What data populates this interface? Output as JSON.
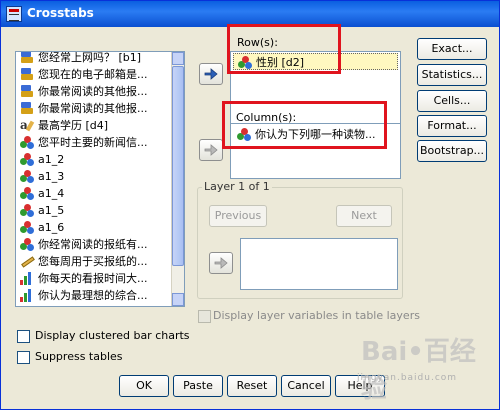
{
  "window": {
    "title": "Crosstabs"
  },
  "variables": [
    {
      "label": "您经常上网吗？ [b1]",
      "icon": "scale"
    },
    {
      "label": "您现在的电子邮箱是...",
      "icon": "scale"
    },
    {
      "label": "你最常阅读的其他报...",
      "icon": "scale"
    },
    {
      "label": "你最常阅读的其他报...",
      "icon": "scale"
    },
    {
      "label": "最高学历 [d4]",
      "icon": "a"
    },
    {
      "label": "您平时主要的新闻信...",
      "icon": "nominal"
    },
    {
      "label": "a1_2",
      "icon": "nominal"
    },
    {
      "label": "a1_3",
      "icon": "nominal"
    },
    {
      "label": "a1_4",
      "icon": "nominal"
    },
    {
      "label": "a1_5",
      "icon": "nominal"
    },
    {
      "label": "a1_6",
      "icon": "nominal"
    },
    {
      "label": "你经常阅读的报纸有...",
      "icon": "nominal"
    },
    {
      "label": "您每周用于买报纸的...",
      "icon": "ruler"
    },
    {
      "label": "你每天的看报时间大...",
      "icon": "ordinal"
    },
    {
      "label": "你认为最理想的综合...",
      "icon": "ordinal"
    }
  ],
  "rows": {
    "label": "Row(s):",
    "items": [
      {
        "label": "性别 [d2]",
        "icon": "nominal"
      }
    ]
  },
  "columns": {
    "label": "Column(s):",
    "items": [
      {
        "label": "你认为下列哪一种读物...",
        "icon": "nominal"
      }
    ]
  },
  "layer": {
    "title": "Layer 1 of 1",
    "previous": "Previous",
    "next": "Next"
  },
  "side_buttons": {
    "exact": "Exact...",
    "statistics": "Statistics...",
    "cells": "Cells...",
    "format": "Format...",
    "bootstrap": "Bootstrap..."
  },
  "options": {
    "display_layer": "Display layer variables in table layers",
    "clustered": "Display clustered bar charts",
    "suppress": "Suppress tables"
  },
  "bottom_buttons": {
    "ok": "OK",
    "paste": "Paste",
    "reset": "Reset",
    "cancel": "Cancel",
    "help": "Help"
  },
  "watermark": {
    "text": "Bai•百经验",
    "sub": "jingyan.baidu.com"
  }
}
